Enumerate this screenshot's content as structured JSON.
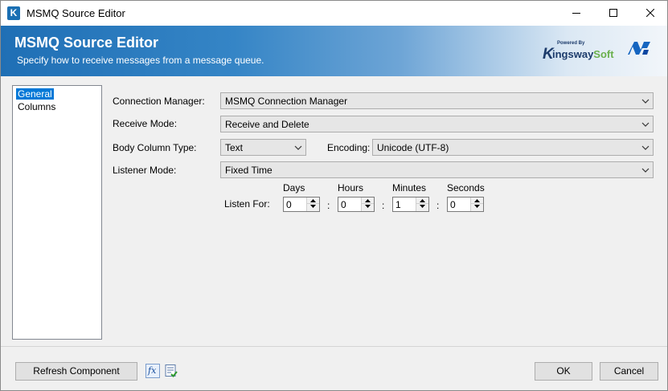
{
  "window": {
    "title": "MSMQ Source Editor",
    "app_icon_letter": "K"
  },
  "banner": {
    "title": "MSMQ Source Editor",
    "subtitle": "Specify how to receive messages from a message queue.",
    "brand_powered": "Powered By",
    "brand_k": "K",
    "brand_name_main": "ingsway",
    "brand_name_accent": "Soft"
  },
  "nav": {
    "items": [
      {
        "label": "General",
        "selected": true
      },
      {
        "label": "Columns",
        "selected": false
      }
    ]
  },
  "form": {
    "connection_manager": {
      "label": "Connection Manager:",
      "value": "MSMQ Connection Manager"
    },
    "receive_mode": {
      "label": "Receive Mode:",
      "value": "Receive and Delete"
    },
    "body_column_type": {
      "label": "Body Column Type:",
      "value": "Text"
    },
    "encoding": {
      "label": "Encoding:",
      "value": "Unicode (UTF-8)"
    },
    "listener_mode": {
      "label": "Listener Mode:",
      "value": "Fixed Time"
    },
    "listen_for": {
      "label": "Listen For:",
      "separator": ":",
      "days": {
        "label": "Days",
        "value": "0"
      },
      "hours": {
        "label": "Hours",
        "value": "0"
      },
      "minutes": {
        "label": "Minutes",
        "value": "1"
      },
      "seconds": {
        "label": "Seconds",
        "value": "0"
      }
    }
  },
  "footer": {
    "refresh_label": "Refresh Component",
    "expression_icon_text": "fx",
    "ok_label": "OK",
    "cancel_label": "Cancel"
  },
  "colors": {
    "accent": "#0078d7",
    "banner_start": "#1f6fb5",
    "brand_navy": "#1c3b6b",
    "brand_green": "#6ab04c"
  }
}
